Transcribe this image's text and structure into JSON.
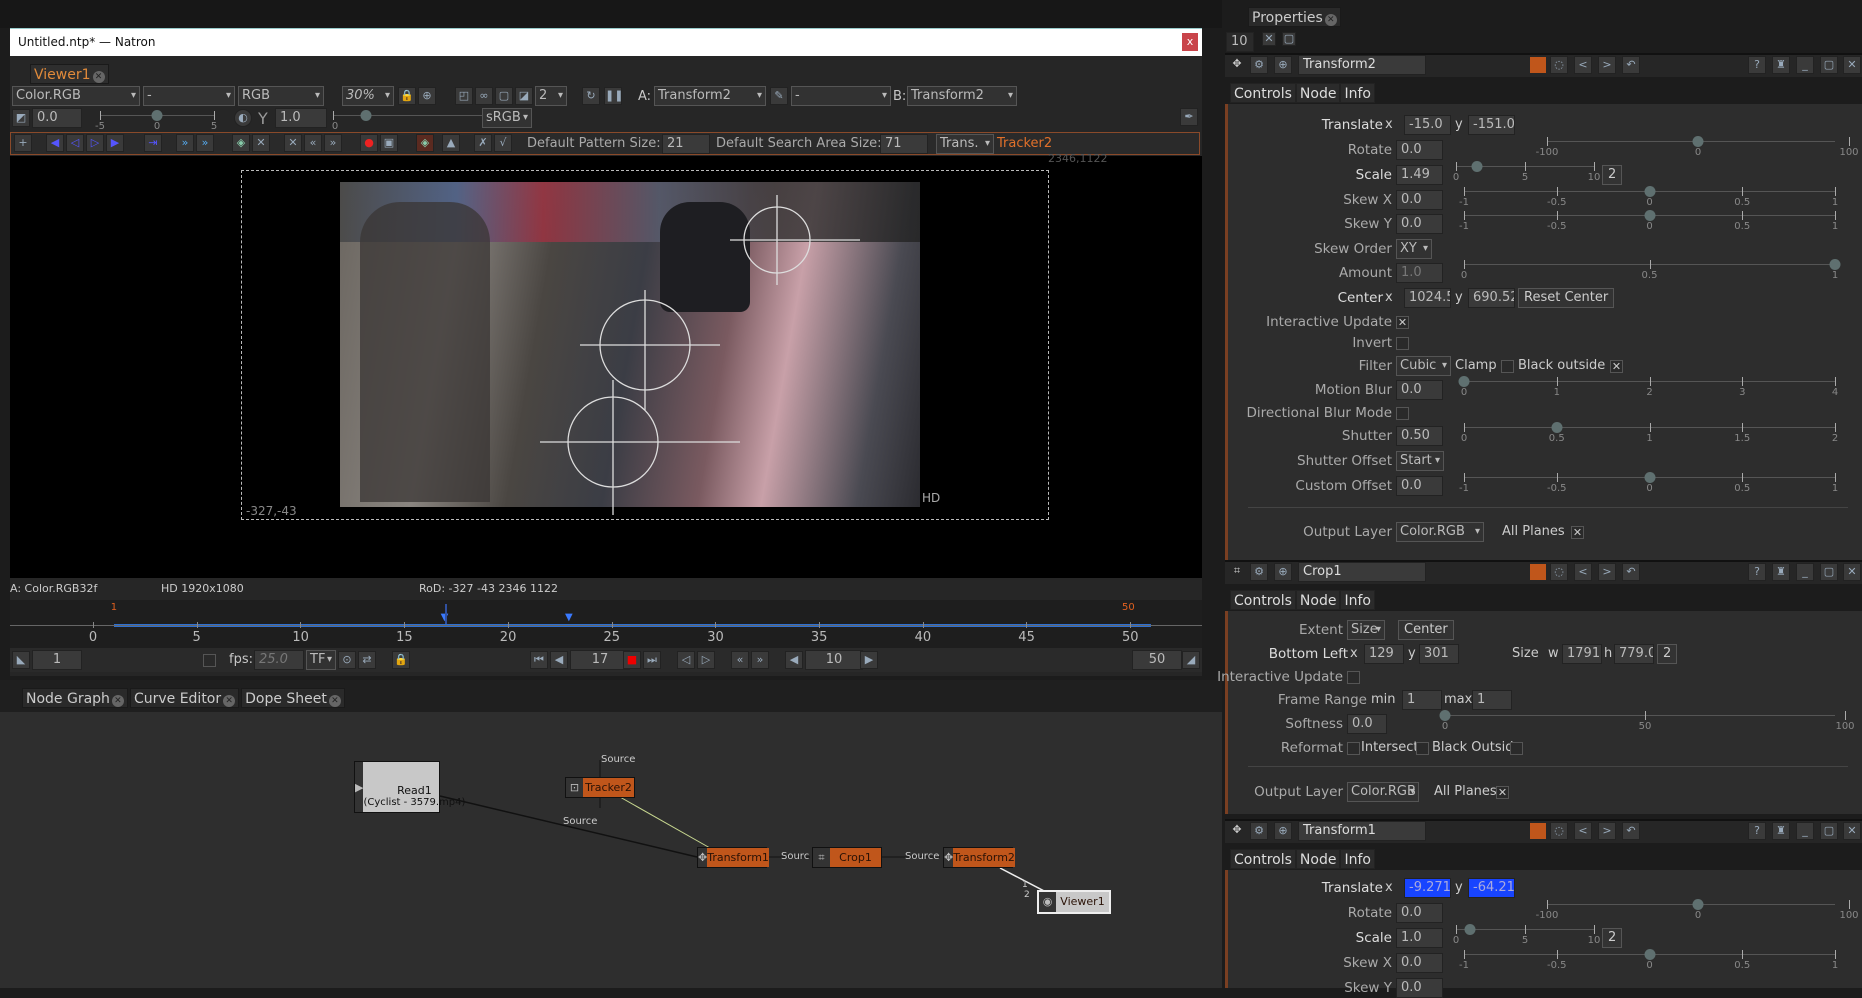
{
  "window": {
    "title": "Untitled.ntp* — Natron",
    "close_label": "x"
  },
  "viewer": {
    "tab_label": "Viewer1",
    "layer": "Color.RGB",
    "alpha": "-",
    "channels": "RGB",
    "zoom": "30%",
    "proxy_level": "2",
    "input_a_label": "A:",
    "input_a": "Transform2",
    "composite": "-",
    "input_b_label": "B:",
    "input_b": "Transform2",
    "gain": "0.0",
    "gain_ticks": [
      "-5",
      "0",
      "5"
    ],
    "gamma_label": "Y",
    "gamma": "1.0",
    "gamma_tick": "0",
    "colorspace": "sRGB",
    "tracker": {
      "pattern_label": "Default Pattern Size:",
      "pattern_size": "21",
      "search_label": "Default Search Area Size:",
      "search_size": "71",
      "mode": "Trans.",
      "node": "Tracker2"
    },
    "corner_top_right": "2346,1122",
    "corner_bottom_left": "-327,-43",
    "format_label": "HD",
    "info": {
      "layer": "A: Color.RGB32f",
      "format": "HD 1920x1080",
      "rod": "RoD: -327 -43 2346 1122"
    }
  },
  "timeline": {
    "ticks": [
      "0",
      "5",
      "10",
      "15",
      "20",
      "25",
      "30",
      "35",
      "40",
      "45",
      "50"
    ],
    "range_start": 0,
    "range_end": 50,
    "in_point": "1",
    "out_point": "50",
    "current_frame": 17,
    "keyframes": [
      17,
      23
    ],
    "start_field": "1",
    "fps_label": "fps:",
    "fps": "25.0",
    "tf": "TF",
    "frame": "17",
    "step": "10",
    "end_field": "50"
  },
  "bottom_tabs": [
    "Node Graph",
    "Curve Editor",
    "Dope Sheet"
  ],
  "node_graph": {
    "read": {
      "name": "Read1",
      "file": "(Cyclist - 3579.mp4)"
    },
    "tracker": "Tracker2",
    "transform1": "Transform1",
    "crop": "Crop1",
    "transform2": "Transform2",
    "viewer": "Viewer1",
    "edge_labels": {
      "tracker_in": "Source",
      "read_out": "Source",
      "t1_out": "Source",
      "crop_out": "Source",
      "viewer_in_1": "1",
      "viewer_in_2": "2"
    }
  },
  "properties": {
    "title": "Properties",
    "max_panels": "10",
    "tabs": [
      "Controls",
      "Node",
      "Info"
    ],
    "accent": "#c0561b",
    "transform2": {
      "name": "Transform2",
      "translate": {
        "label": "Translate",
        "x_label": "x",
        "x": "-15.0",
        "y_label": "y",
        "y": "-151.0"
      },
      "rotate": {
        "label": "Rotate",
        "value": "0.0",
        "ticks": [
          "-100",
          "0",
          "100"
        ],
        "level": 0
      },
      "scale": {
        "label": "Scale",
        "value": "1.49",
        "ticks": [
          "0",
          "5",
          "10"
        ],
        "level": 1.49,
        "dims": "2"
      },
      "skew_x": {
        "label": "Skew X",
        "value": "0.0",
        "ticks": [
          "-1",
          "-0.5",
          "0",
          "0.5",
          "1"
        ],
        "level": 0
      },
      "skew_y": {
        "label": "Skew Y",
        "value": "0.0",
        "ticks": [
          "-1",
          "-0.5",
          "0",
          "0.5",
          "1"
        ],
        "level": 0
      },
      "skew_order": {
        "label": "Skew Order",
        "value": "XY"
      },
      "amount": {
        "label": "Amount",
        "value": "1.0",
        "ticks": [
          "0",
          "0.5",
          "1"
        ],
        "level": 1
      },
      "center": {
        "label": "Center",
        "x_label": "x",
        "x": "1024.5",
        "y_label": "y",
        "y": "690.52",
        "reset": "Reset Center"
      },
      "interactive_update": {
        "label": "Interactive Update",
        "checked": true
      },
      "invert": {
        "label": "Invert",
        "checked": false
      },
      "filter": {
        "label": "Filter",
        "value": "Cubic",
        "clamp_label": "Clamp",
        "clamp": false,
        "black_outside_label": "Black outside",
        "black_outside": true
      },
      "motion_blur": {
        "label": "Motion Blur",
        "value": "0.0",
        "ticks": [
          "0",
          "1",
          "2",
          "3",
          "4"
        ],
        "level": 0
      },
      "directional_blur": {
        "label": "Directional Blur Mode",
        "checked": false
      },
      "shutter": {
        "label": "Shutter",
        "value": "0.50",
        "ticks": [
          "0",
          "0.5",
          "1",
          "1.5",
          "2"
        ],
        "level": 0.5
      },
      "shutter_offset": {
        "label": "Shutter Offset",
        "value": "Start"
      },
      "custom_offset": {
        "label": "Custom Offset",
        "value": "0.0",
        "ticks": [
          "-1",
          "-0.5",
          "0",
          "0.5",
          "1"
        ],
        "level": 0
      },
      "output_layer": {
        "label": "Output Layer",
        "value": "Color.RGB",
        "all_planes_label": "All Planes",
        "all_planes": true
      }
    },
    "crop1": {
      "name": "Crop1",
      "extent": {
        "label": "Extent",
        "value": "Size",
        "center": "Center"
      },
      "bottom_left": {
        "label": "Bottom Left",
        "x_label": "x",
        "x": "129",
        "y_label": "y",
        "y": "301"
      },
      "size": {
        "label": "Size",
        "w_label": "w",
        "w": "1791.0",
        "h_label": "h",
        "h": "779.04",
        "dims": "2"
      },
      "interactive_update": {
        "label": "Interactive Update",
        "checked": false
      },
      "frame_range": {
        "label": "Frame Range",
        "min_label": "min",
        "min": "1",
        "max_label": "max",
        "max": "1"
      },
      "softness": {
        "label": "Softness",
        "value": "0.0",
        "ticks": [
          "0",
          "50",
          "100"
        ],
        "level": 0
      },
      "reformat": {
        "label": "Reformat",
        "checked": false,
        "intersect_label": "Intersect",
        "intersect": false,
        "black_outside_label": "Black Outside",
        "black_outside": false
      },
      "output_layer": {
        "label": "Output Layer",
        "value": "Color.RGB",
        "all_planes_label": "All Planes",
        "all_planes": true
      }
    },
    "transform1": {
      "name": "Transform1",
      "translate": {
        "label": "Translate",
        "x_label": "x",
        "x": "-9.271",
        "y_label": "y",
        "y": "-64.21"
      },
      "rotate": {
        "label": "Rotate",
        "value": "0.0",
        "ticks": [
          "-100",
          "0",
          "100"
        ],
        "level": 0
      },
      "scale": {
        "label": "Scale",
        "value": "1.0",
        "ticks": [
          "0",
          "5",
          "10"
        ],
        "level": 1,
        "dims": "2"
      },
      "skew_x": {
        "label": "Skew X",
        "value": "0.0",
        "ticks": [
          "-1",
          "-0.5",
          "0",
          "0.5",
          "1"
        ],
        "level": 0
      },
      "skew_y": {
        "label": "Skew Y",
        "value": "0.0"
      }
    }
  }
}
